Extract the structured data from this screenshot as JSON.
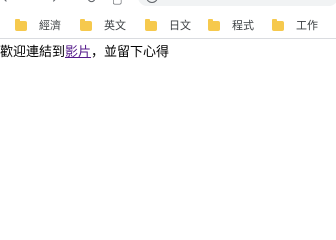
{
  "bookmarks": [
    {
      "label": "經濟"
    },
    {
      "label": "英文"
    },
    {
      "label": "日文"
    },
    {
      "label": "程式"
    },
    {
      "label": "工作"
    }
  ],
  "page": {
    "text_before": "歡迎連結到",
    "link_text": "影片",
    "text_after": "，並留下心得"
  },
  "colors": {
    "folder": "#f6c94d",
    "visited_link": "#551a8b",
    "bookmark_text": "#3c4043"
  }
}
